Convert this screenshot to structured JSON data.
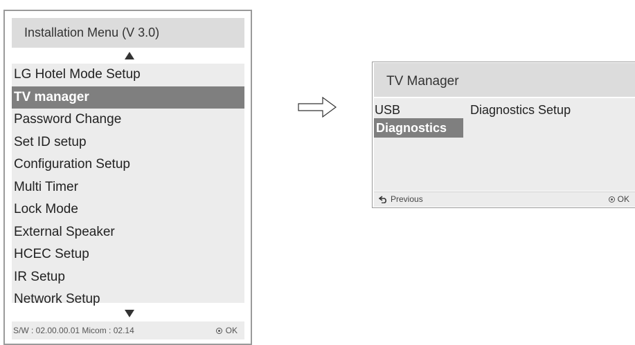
{
  "installation_menu": {
    "title": "Installation Menu (V 3.0)",
    "items": [
      {
        "label": "LG Hotel Mode Setup"
      },
      {
        "label": "TV manager",
        "selected": true
      },
      {
        "label": "Password Change"
      },
      {
        "label": "Set ID setup"
      },
      {
        "label": "Configuration Setup"
      },
      {
        "label": "Multi Timer"
      },
      {
        "label": "Lock Mode"
      },
      {
        "label": "External Speaker"
      },
      {
        "label": "HCEC Setup"
      },
      {
        "label": "IR Setup"
      },
      {
        "label": "Network Setup"
      }
    ],
    "footer": {
      "version": "S/W : 02.00.00.01 Micom : 02.14",
      "ok_label": "OK"
    }
  },
  "tv_manager": {
    "title": "TV Manager",
    "usb_label": "USB",
    "diagnostics_setup_label": "Diagnostics Setup",
    "diagnostics_label": "Diagnostics",
    "footer": {
      "previous_label": "Previous",
      "ok_label": "OK"
    }
  },
  "colors": {
    "title_bar": "#dcdcdc",
    "panel_bg": "#ececec",
    "selected_bg": "#7f7f7f",
    "border": "#9a9a9a"
  }
}
